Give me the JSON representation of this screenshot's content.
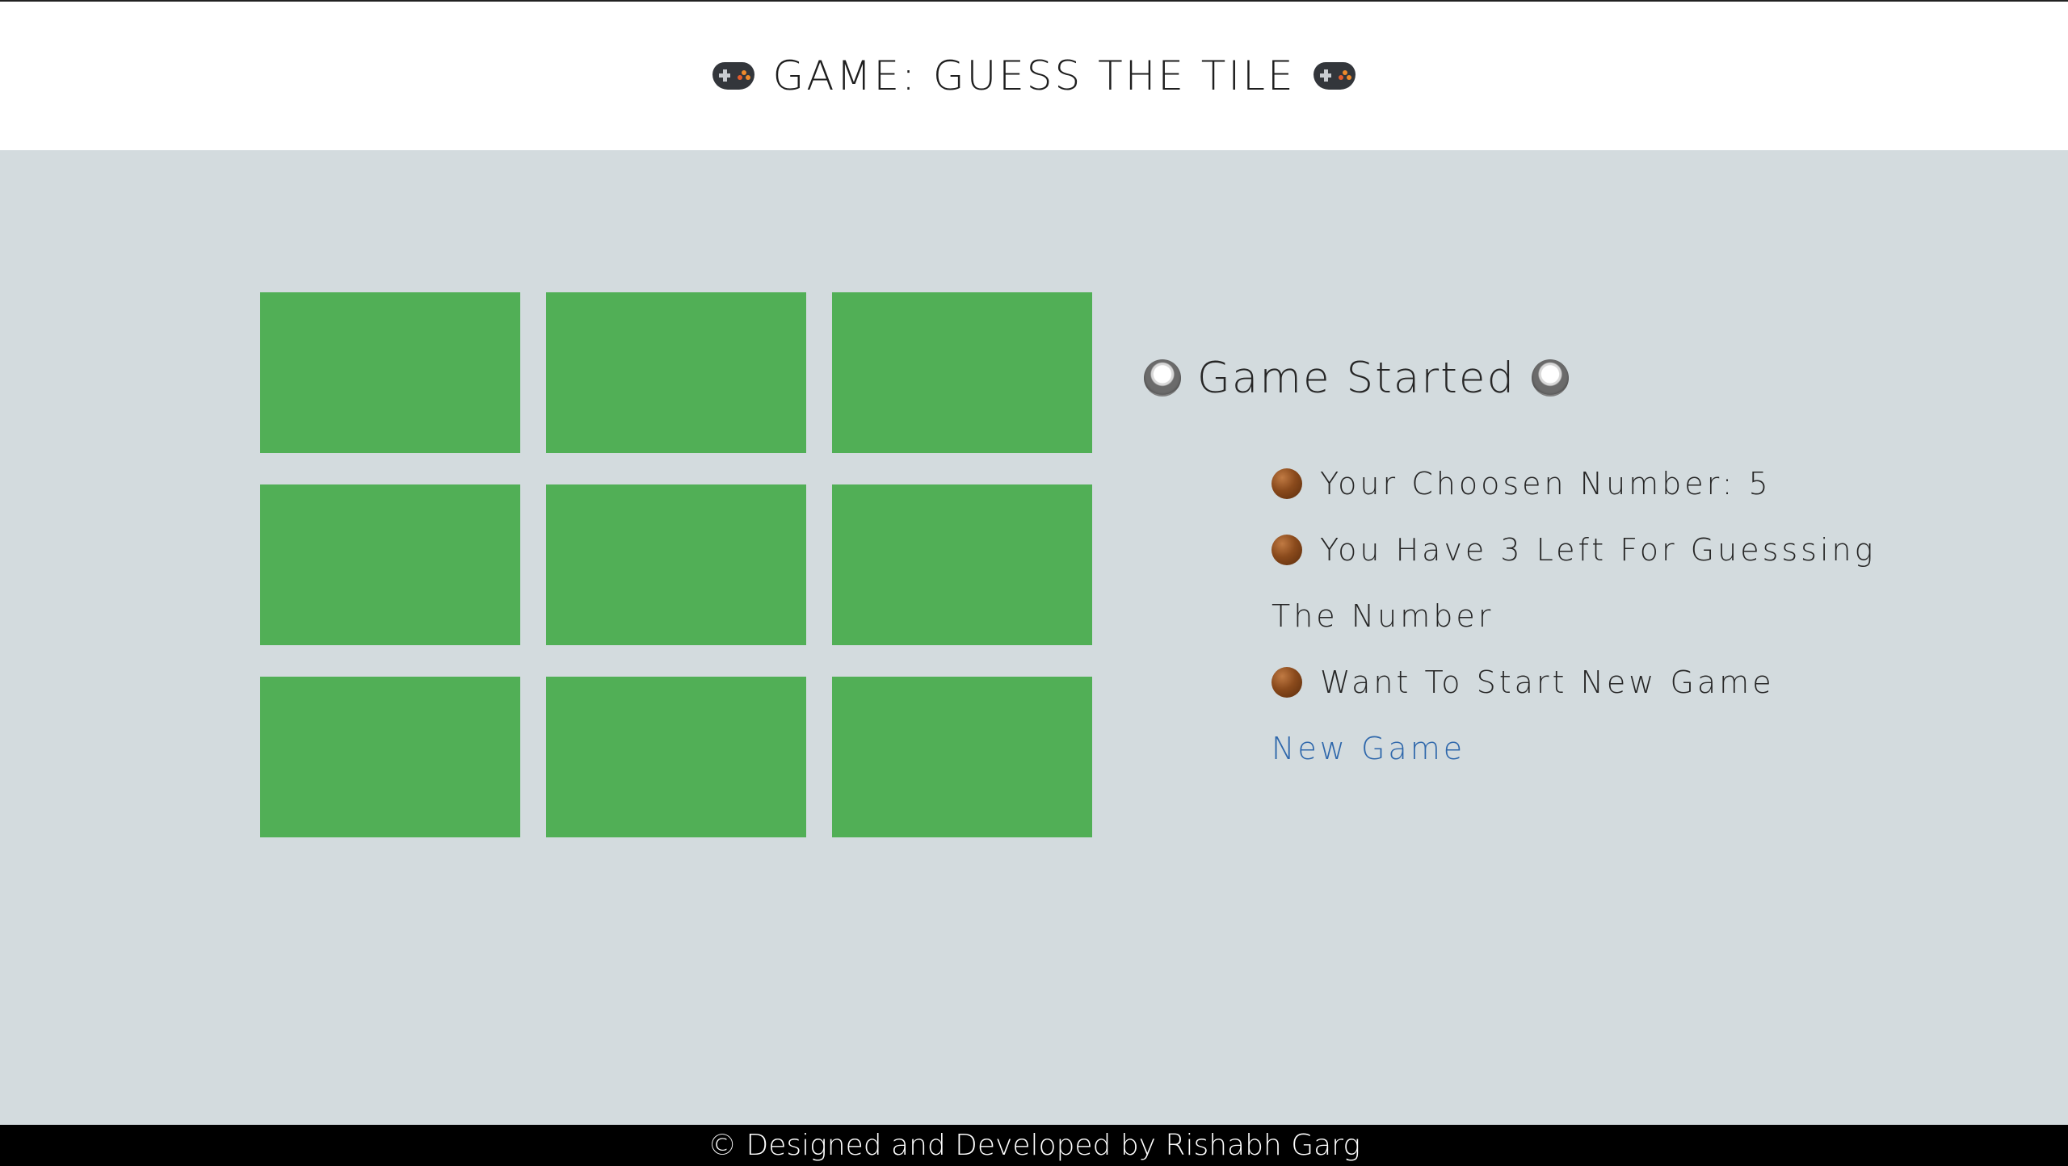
{
  "header": {
    "title": "GAME: GUESS THE TILE",
    "left_icon": "gamepad-icon",
    "right_icon": "gamepad-icon"
  },
  "board": {
    "tile_color": "#51af56",
    "tiles": [
      "",
      "",
      "",
      "",
      "",
      "",
      "",
      "",
      ""
    ]
  },
  "panel": {
    "status": "Game Started",
    "status_icon": "radio-button-icon",
    "bullet_icon": "brown-circle-icon",
    "chosen_number": "Your Choosen Number: 5",
    "guesses_left_line1": "You Have 3 Left For Guesssing",
    "guesses_left_line2": "The Number",
    "new_game_prompt": "Want To Start New Game",
    "new_game_link": "New Game",
    "link_color": "#2e67ab"
  },
  "footer": {
    "credit": "© Designed and Developed by Rishabh Garg"
  },
  "colors": {
    "page_background": "#d3dbde",
    "header_background": "#ffffff",
    "footer_background": "#000000"
  }
}
